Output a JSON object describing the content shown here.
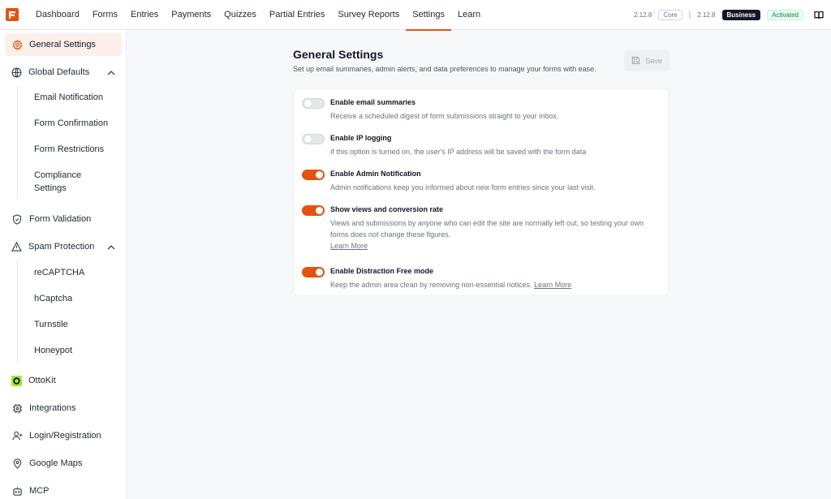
{
  "topbar": {
    "nav": [
      {
        "label": "Dashboard"
      },
      {
        "label": "Forms"
      },
      {
        "label": "Entries"
      },
      {
        "label": "Payments"
      },
      {
        "label": "Quizzes"
      },
      {
        "label": "Partial Entries"
      },
      {
        "label": "Survey Reports"
      },
      {
        "label": "Settings"
      },
      {
        "label": "Learn"
      }
    ],
    "active_nav": "Settings",
    "core_version": "2.12.8",
    "core_label": "Core",
    "separator": "|",
    "business_version": "2.12.8",
    "business_label": "Business",
    "status_label": "Activated",
    "colors": {
      "accent": "#e2530f",
      "dark_badge": "#111827",
      "status_green": "#15803d"
    }
  },
  "sidebar": {
    "general_settings": "General Settings",
    "global_defaults": "Global Defaults",
    "global_defaults_items": [
      "Email Notification",
      "Form Confirmation",
      "Form Restrictions",
      "Compliance Settings"
    ],
    "form_validation": "Form Validation",
    "spam_protection": "Spam Protection",
    "spam_items": [
      "reCAPTCHA",
      "hCaptcha",
      "Turnstile",
      "Honeypot"
    ],
    "ottokit": "OttoKit",
    "integrations": "Integrations",
    "login_registration": "Login/Registration",
    "google_maps": "Google Maps",
    "mcp": "MCP"
  },
  "main": {
    "title": "General Settings",
    "description": "Set up email summaries, admin alerts, and data preferences to manage your forms with ease.",
    "save_label": "Save",
    "settings": [
      {
        "title": "Enable email summaries",
        "description": "Receive a scheduled digest of form submissions straight to your inbox.",
        "enabled": false
      },
      {
        "title": "Enable IP logging",
        "description": "If this option is turned on, the user's IP address will be saved with the form data",
        "enabled": false
      },
      {
        "title": "Enable Admin Notification",
        "description": "Admin notifications keep you informed about new form entries since your last visit.",
        "enabled": true
      },
      {
        "title": "Show views and conversion rate",
        "description": "Views and submissions by anyone who can edit the site are normally left out, so testing your own forms does not change these figures.",
        "link": "Learn More",
        "enabled": true
      },
      {
        "title": "Enable Distraction Free mode",
        "description": "Keep the admin area clean by removing non-essential notices.",
        "link": "Learn More",
        "enabled": true
      }
    ]
  }
}
